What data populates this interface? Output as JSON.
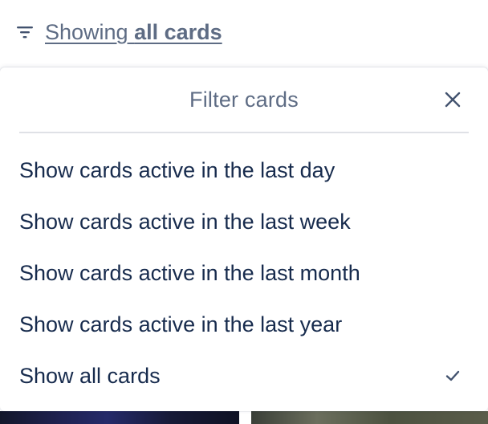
{
  "trigger": {
    "prefix": "Showing",
    "value": "all cards",
    "icon": "filter-icon"
  },
  "popover": {
    "title": "Filter cards",
    "close_icon": "close-icon",
    "options": [
      {
        "label": "Show cards active in the last day",
        "selected": false
      },
      {
        "label": "Show cards active in the last week",
        "selected": false
      },
      {
        "label": "Show cards active in the last month",
        "selected": false
      },
      {
        "label": "Show cards active in the last year",
        "selected": false
      },
      {
        "label": "Show all cards",
        "selected": true
      }
    ],
    "selected_icon": "check-icon"
  },
  "colors": {
    "muted_text": "#5e6c84",
    "primary_text": "#172b4d",
    "divider": "#dfe1e6"
  }
}
